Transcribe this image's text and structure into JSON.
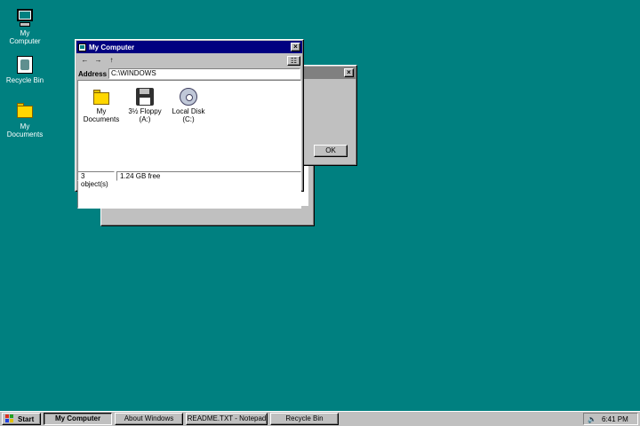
{
  "desktop": {
    "background_color": "#008080",
    "icons": [
      {
        "label_line1": "My",
        "label_line2": "Computer",
        "icon": "computer-icon"
      },
      {
        "label_line1": "Recycle Bin",
        "label_line2": "",
        "icon": "recycle-bin-icon"
      },
      {
        "label_line1": "My",
        "label_line2": "Documents",
        "icon": "folder-icon"
      }
    ]
  },
  "about_window": {
    "title": "",
    "close_glyph": "×"
  },
  "notepad_window": {
    "title": "",
    "close_glyph": "×",
    "ok_label": "OK"
  },
  "my_computer": {
    "title": "My Computer",
    "close_glyph": "×",
    "toolbar": {
      "back": "←",
      "forward": "→",
      "up": "↑",
      "views": "☷"
    },
    "address_label": "Address",
    "address_value": "C:\\WINDOWS",
    "items": [
      {
        "line1": "My",
        "line2": "Documents",
        "icon": "folder-icon"
      },
      {
        "line1": "3½ Floppy",
        "line2": "(A:)",
        "icon": "floppy-icon"
      },
      {
        "line1": "Local Disk",
        "line2": "(C:)",
        "icon": "hard-disk-icon"
      }
    ],
    "status": {
      "objects": "3 object(s)",
      "free": "1.24 GB free"
    }
  },
  "taskbar": {
    "start_label": "Start",
    "buttons": [
      {
        "label": "My Computer",
        "active": true
      },
      {
        "label": "About Windows",
        "active": false
      },
      {
        "label": "README.TXT - Notepad",
        "active": false
      },
      {
        "label": "Recycle Bin",
        "active": false
      }
    ],
    "tray": {
      "volume_icon": "volume-icon",
      "time": "6:41 PM"
    }
  },
  "colors": {
    "title_active": "#000080",
    "title_inactive": "#808080",
    "face": "#c0c0c0"
  }
}
